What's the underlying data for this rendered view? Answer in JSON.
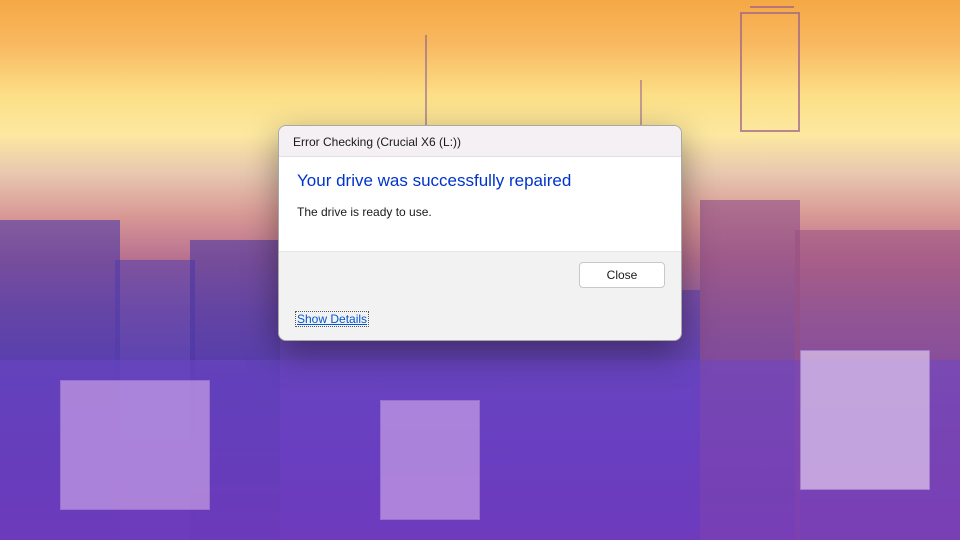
{
  "dialog": {
    "title": "Error Checking (Crucial X6 (L:))",
    "heading": "Your drive was successfully repaired",
    "message": "The drive is ready to use.",
    "close_label": "Close",
    "details_label": "Show Details"
  }
}
